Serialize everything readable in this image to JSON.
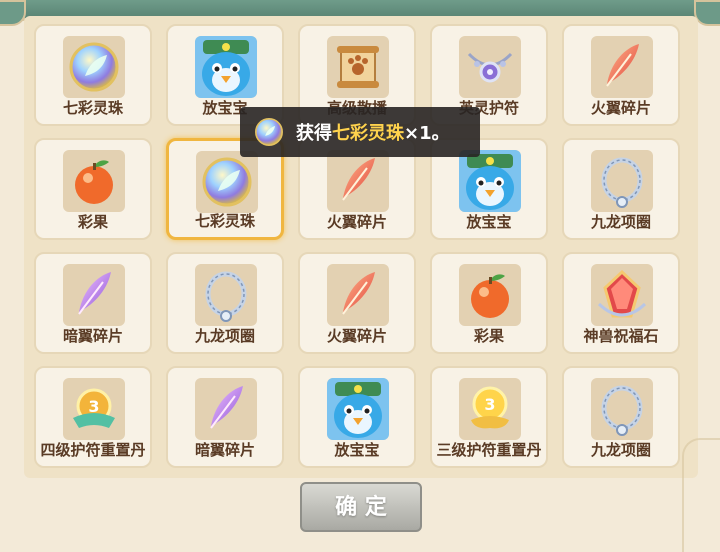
{
  "items": [
    {
      "label": "七彩灵珠",
      "icon": "rainbow-orb-icon"
    },
    {
      "label": "放宝宝",
      "icon": "blue-chick-icon"
    },
    {
      "label": "高级散播",
      "icon": "scroll-icon"
    },
    {
      "label": "英灵护符",
      "icon": "amulet-icon"
    },
    {
      "label": "火翼碎片",
      "icon": "fire-feather-icon"
    },
    {
      "label": "彩果",
      "icon": "fruit-icon"
    },
    {
      "label": "七彩灵珠",
      "icon": "rainbow-orb-icon"
    },
    {
      "label": "火翼碎片",
      "icon": "fire-feather-icon"
    },
    {
      "label": "放宝宝",
      "icon": "blue-chick-icon"
    },
    {
      "label": "九龙项圈",
      "icon": "necklace-icon"
    },
    {
      "label": "暗翼碎片",
      "icon": "dark-feather-icon"
    },
    {
      "label": "九龙项圈",
      "icon": "necklace-icon"
    },
    {
      "label": "火翼碎片",
      "icon": "fire-feather-icon"
    },
    {
      "label": "彩果",
      "icon": "fruit-icon"
    },
    {
      "label": "神兽祝福石",
      "icon": "crystal-icon"
    },
    {
      "label": "四级护符重置丹",
      "icon": "charm-pill-4-icon"
    },
    {
      "label": "暗翼碎片",
      "icon": "dark-feather-icon"
    },
    {
      "label": "放宝宝",
      "icon": "blue-chick-icon"
    },
    {
      "label": "三级护符重置丹",
      "icon": "charm-pill-3-icon"
    },
    {
      "label": "九龙项圈",
      "icon": "necklace-icon"
    }
  ],
  "toast": {
    "prefix": "获得",
    "item": "七彩灵珠",
    "suffix": "×1。",
    "icon": "rainbow-orb-icon"
  },
  "confirm_label": "确 定",
  "selected_index": 6
}
